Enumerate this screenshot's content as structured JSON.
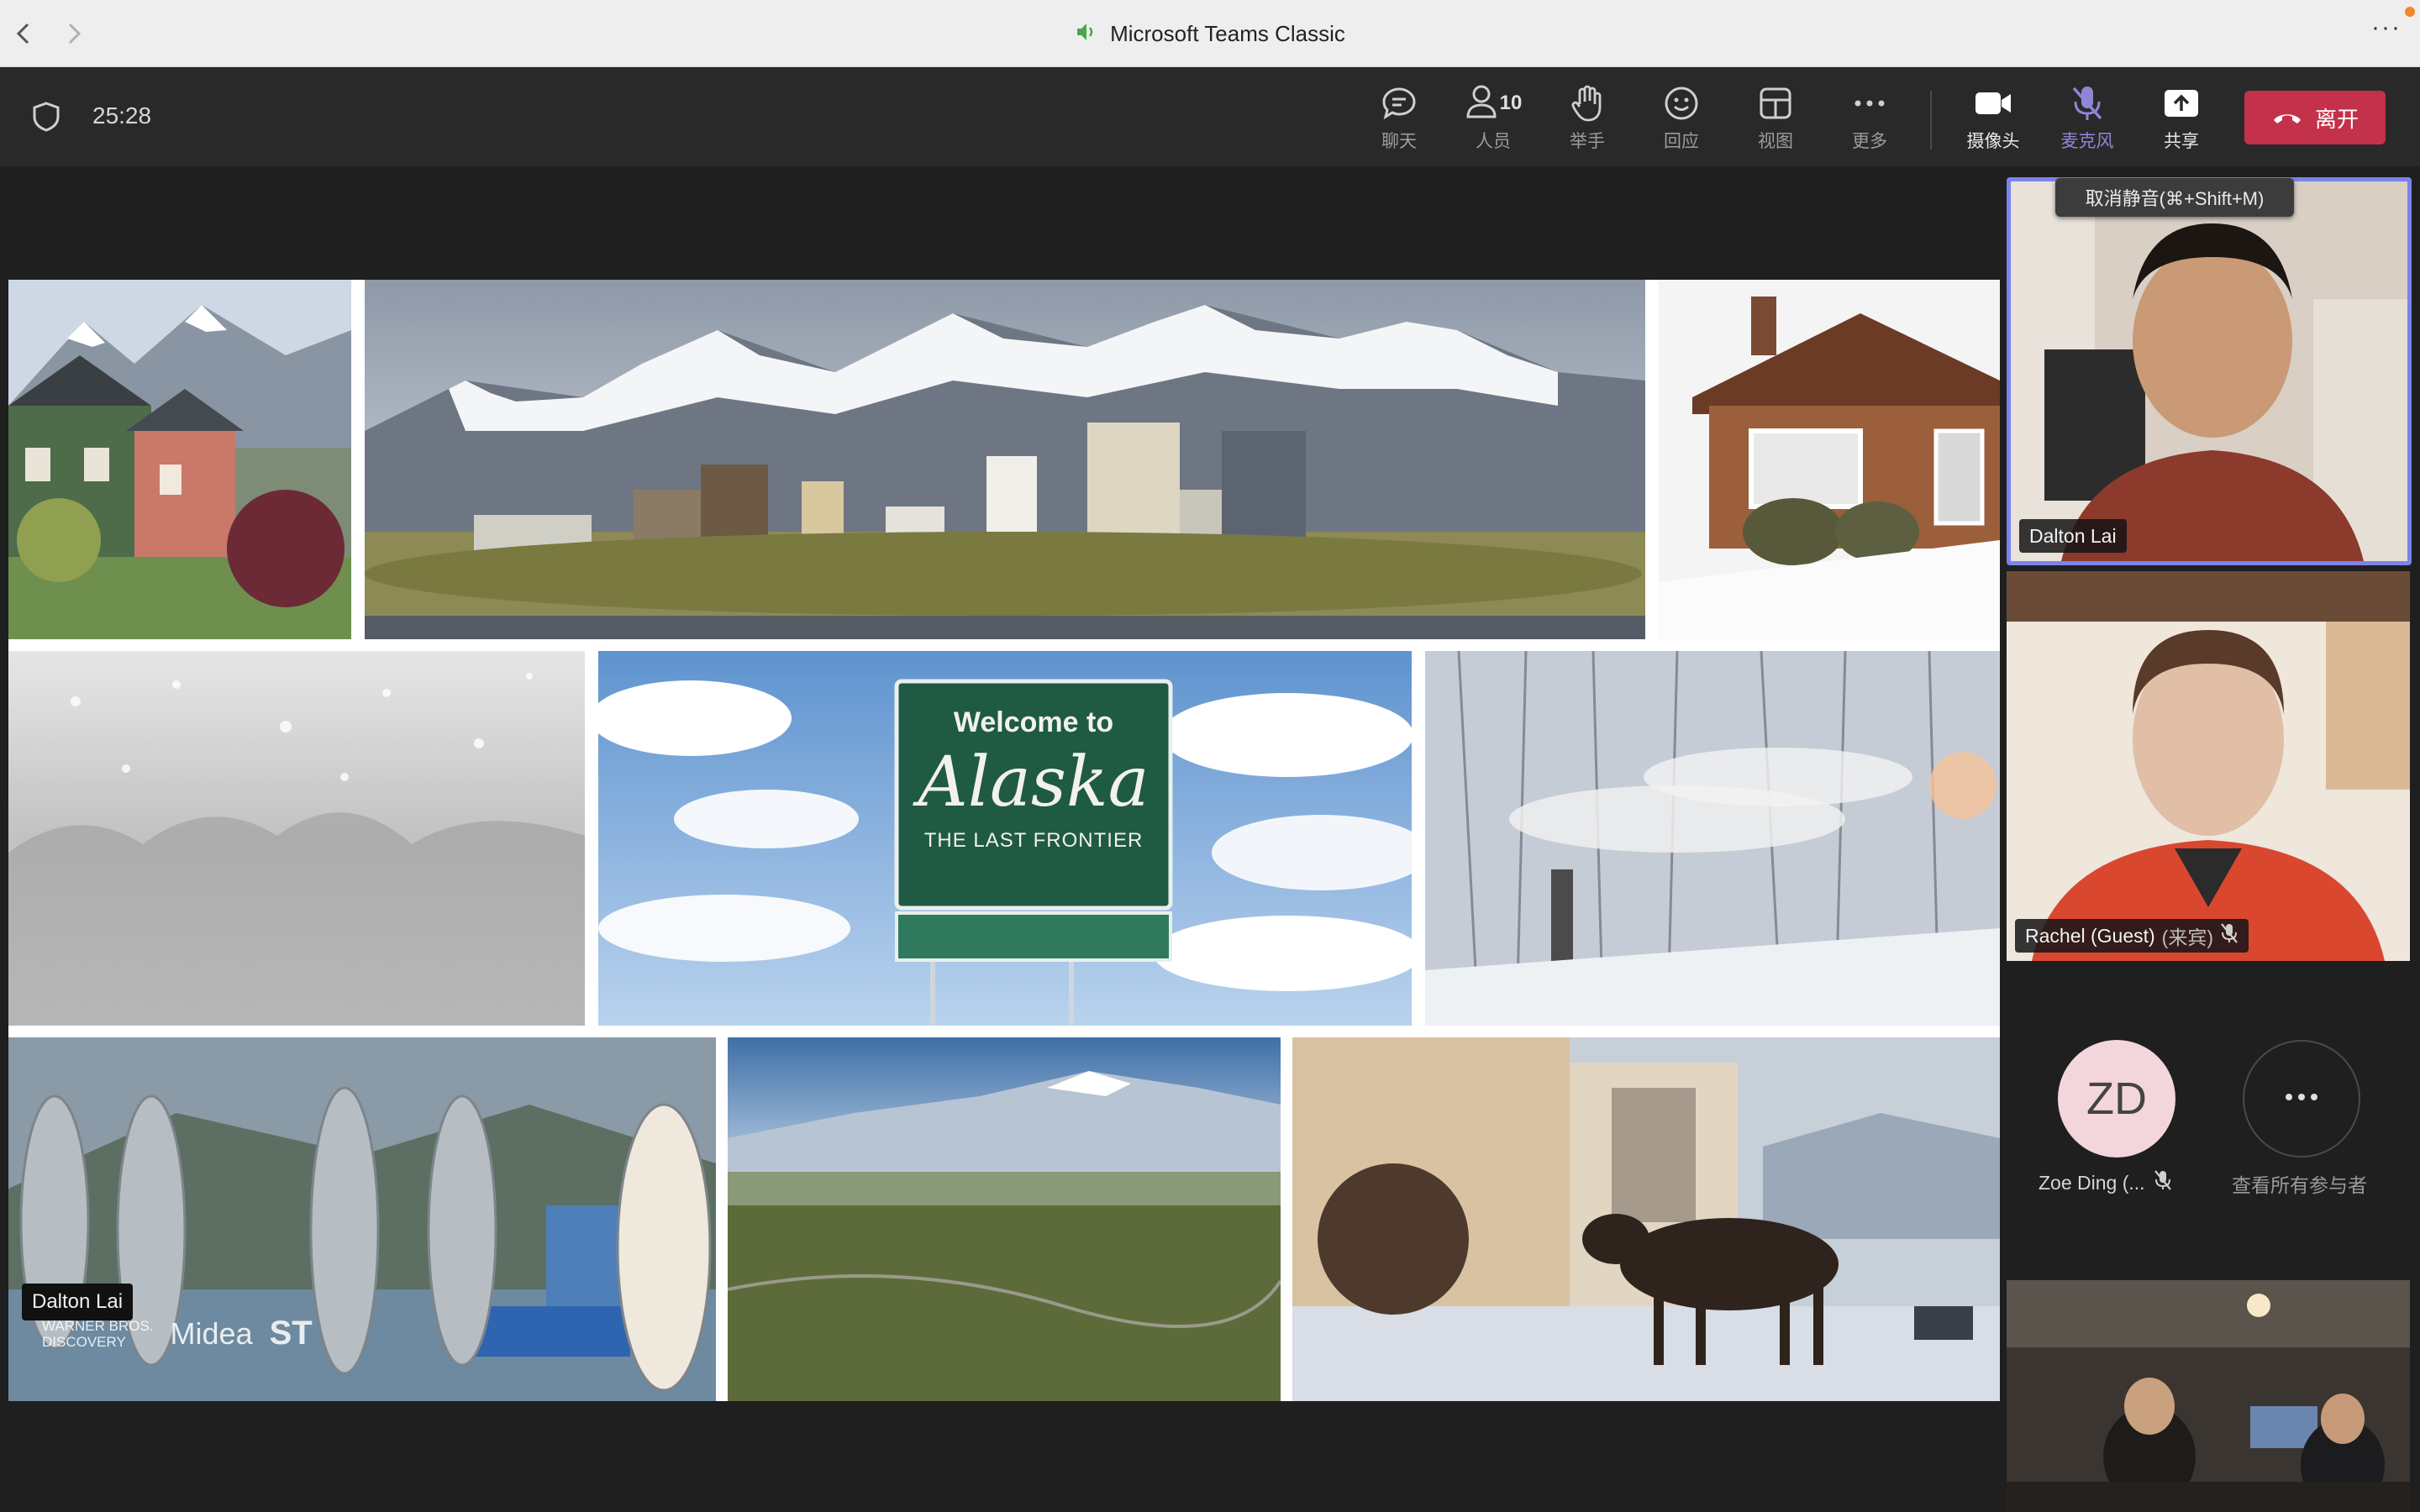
{
  "window": {
    "title": "Microsoft Teams Classic",
    "more_glyph": "···"
  },
  "meeting": {
    "timer": "25:28",
    "tools": {
      "chat": "聊天",
      "people": "人员",
      "people_count": "10",
      "raise_hand": "举手",
      "react": "回应",
      "view": "视图",
      "more": "更多",
      "camera": "摄像头",
      "mic": "麦克风",
      "share": "共享"
    },
    "leave_label": "离开",
    "tooltip": "取消静音(⌘+Shift+M)"
  },
  "shared_content": {
    "presenter_name": "Dalton Lai",
    "sign": {
      "line1": "Welcome to",
      "line2": "Alaska",
      "line3": "THE LAST FRONTIER"
    },
    "watermark": {
      "brand1": "WARNER BROS.",
      "brand1b": "DISCOVERY",
      "brand2": "Midea",
      "brand3": "ST"
    }
  },
  "participants": {
    "p1": {
      "name": "Dalton Lai"
    },
    "p2": {
      "name": "Rachel (Guest)",
      "guest_tag": "(来宾)"
    },
    "p3": {
      "initials": "ZD",
      "name": "Zoe Ding (..."
    },
    "view_all_label": "查看所有参与者"
  },
  "colors": {
    "leave": "#c4314b",
    "active_speaker_border": "#7b83eb",
    "mic_muted_purple": "#8f86d8"
  }
}
